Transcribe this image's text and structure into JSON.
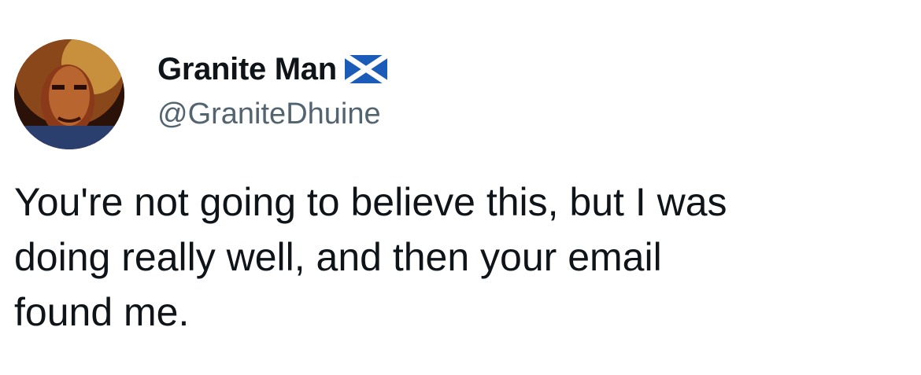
{
  "author": {
    "display_name": "Granite Man",
    "handle": "@GraniteDhuine",
    "badge_icon": "scotland-flag-icon",
    "avatar_icon": "profile-avatar"
  },
  "tweet": {
    "text": "You're not going to believe this, but I was\ndoing really well, and then your email\nfound me."
  },
  "colors": {
    "text": "#0f1419",
    "handle": "#536471",
    "flag_blue": "#1a5cb8",
    "flag_white": "#ffffff"
  }
}
